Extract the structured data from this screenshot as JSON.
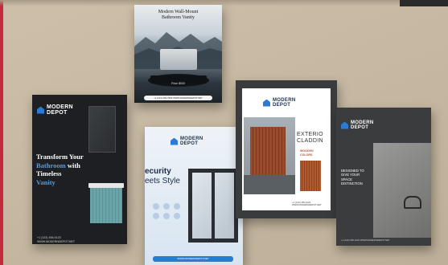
{
  "brand": {
    "line1": "MODERN",
    "line2": "DEPOT"
  },
  "card_vanity": {
    "heading_line1": "Modern Wall-Mount",
    "heading_line2": "Bathroom Vanity",
    "price": "Price $000",
    "footer": "+1 (123) 456-7890  WWW.MODERNDEPOT.NET"
  },
  "card_transform": {
    "headline_line1": "Transform Your",
    "headline_highlight": "Bathroom",
    "headline_line2_rest": "with",
    "headline_line3": "Timeless",
    "headline_line4": "Vanity",
    "phone": "+1 (123) 456-0123",
    "website": "WWW.MODERNDEPOT.NET"
  },
  "card_security": {
    "headline_line1": "ecurity",
    "headline_line2": "eets Style",
    "footer": "WWW.MODERNDEPOT.NET"
  },
  "card_exterior": {
    "title_line1": "EXTERIO",
    "title_line2": "CLADDIN",
    "sub_line1": "WOODEN",
    "sub_line2": "COLORS",
    "footer": "+1 (123) 456-0123  WWW.MODERNDEPOT.NET"
  },
  "card_designs": {
    "text_line1": "DESIGNED TO",
    "text_line2": "GIVE YOUR",
    "text_line3": "SPACE",
    "text_line4": "DISTINCTION",
    "footer": "+1 (123) 456-0123  WWW.MODERNDEPOT.NET"
  }
}
